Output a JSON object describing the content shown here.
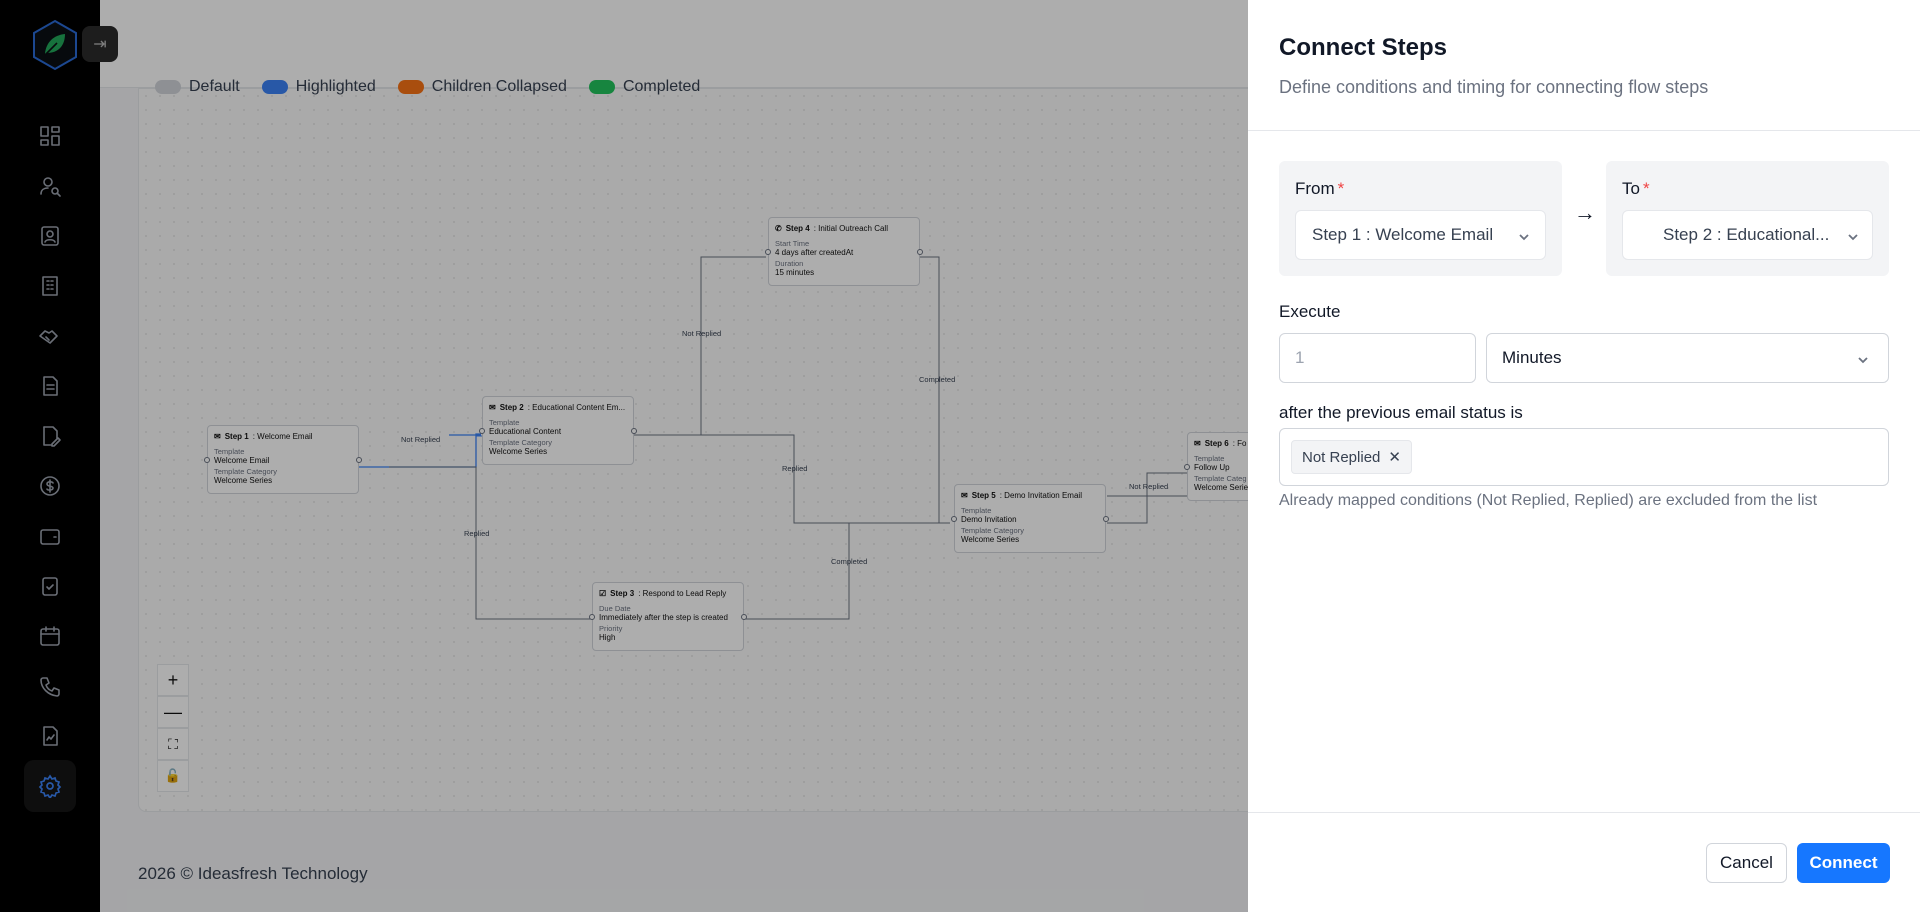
{
  "legend": [
    {
      "label": "Default",
      "color": "#d1d5db"
    },
    {
      "label": "Highlighted",
      "color": "#3b82f6"
    },
    {
      "label": "Children Collapsed",
      "color": "#f97316"
    },
    {
      "label": "Completed",
      "color": "#22c55e"
    }
  ],
  "nodes": {
    "step1": {
      "title_bold": "Step 1",
      "title_rest": " : Welcome Email",
      "l1": "Template",
      "v1": "Welcome Email",
      "l2": "Template Category",
      "v2": "Welcome Series"
    },
    "step2": {
      "title_bold": "Step 2",
      "title_rest": " : Educational Content Em...",
      "l1": "Template",
      "v1": "Educational Content",
      "l2": "Template Category",
      "v2": "Welcome Series"
    },
    "step3": {
      "title_bold": "Step 3",
      "title_rest": " : Respond to Lead Reply",
      "l1": "Due Date",
      "v1": "Immediately after the step is created",
      "l2": "Priority",
      "v2": "High"
    },
    "step4": {
      "title_bold": "Step 4",
      "title_rest": " : Initial Outreach Call",
      "l1": "Start Time",
      "v1": "4 days after createdAt",
      "l2": "Duration",
      "v2": "15 minutes"
    },
    "step5": {
      "title_bold": "Step 5",
      "title_rest": " : Demo Invitation Email",
      "l1": "Template",
      "v1": "Demo Invitation",
      "l2": "Template Category",
      "v2": "Welcome Series"
    },
    "step6": {
      "title_bold": "Step 6",
      "title_rest": " : Fo",
      "l1": "Template",
      "v1": "Follow Up",
      "l2": "Template Categ",
      "v2": "Welcome Serie"
    }
  },
  "edge_labels": {
    "not_replied_1": "Not Replied",
    "replied_1": "Replied",
    "not_replied_2": "Not Replied",
    "replied_2": "Replied",
    "completed_1": "Completed",
    "completed_2": "Completed",
    "overlap": "Not Replied"
  },
  "controls": {
    "zoom_in": "+",
    "zoom_out": "—",
    "fit": "⛶",
    "lock": "🔓"
  },
  "footer": "2026 ©  Ideasfresh Technology",
  "collapse_glyph": "⇥",
  "panel": {
    "title": "Connect Steps",
    "subtitle": "Define conditions and timing for connecting flow steps",
    "from_label": "From",
    "from_value": "Step 1 : Welcome Email",
    "arrow": "→",
    "to_label": "To",
    "to_value": "Step 2 : Educational...",
    "required_mark": "*",
    "execute_label": "Execute",
    "execute_value": "1",
    "unit_value": "Minutes",
    "status_label": "after the previous email status is",
    "status_tag": "Not Replied",
    "tag_remove": "✕",
    "hint": "Already mapped conditions (Not Replied, Replied) are excluded from the list",
    "cancel": "Cancel",
    "connect": "Connect"
  },
  "colors": {
    "accent": "#1677ff",
    "required": "#ef4444",
    "active_icon": "#3b82f6"
  }
}
